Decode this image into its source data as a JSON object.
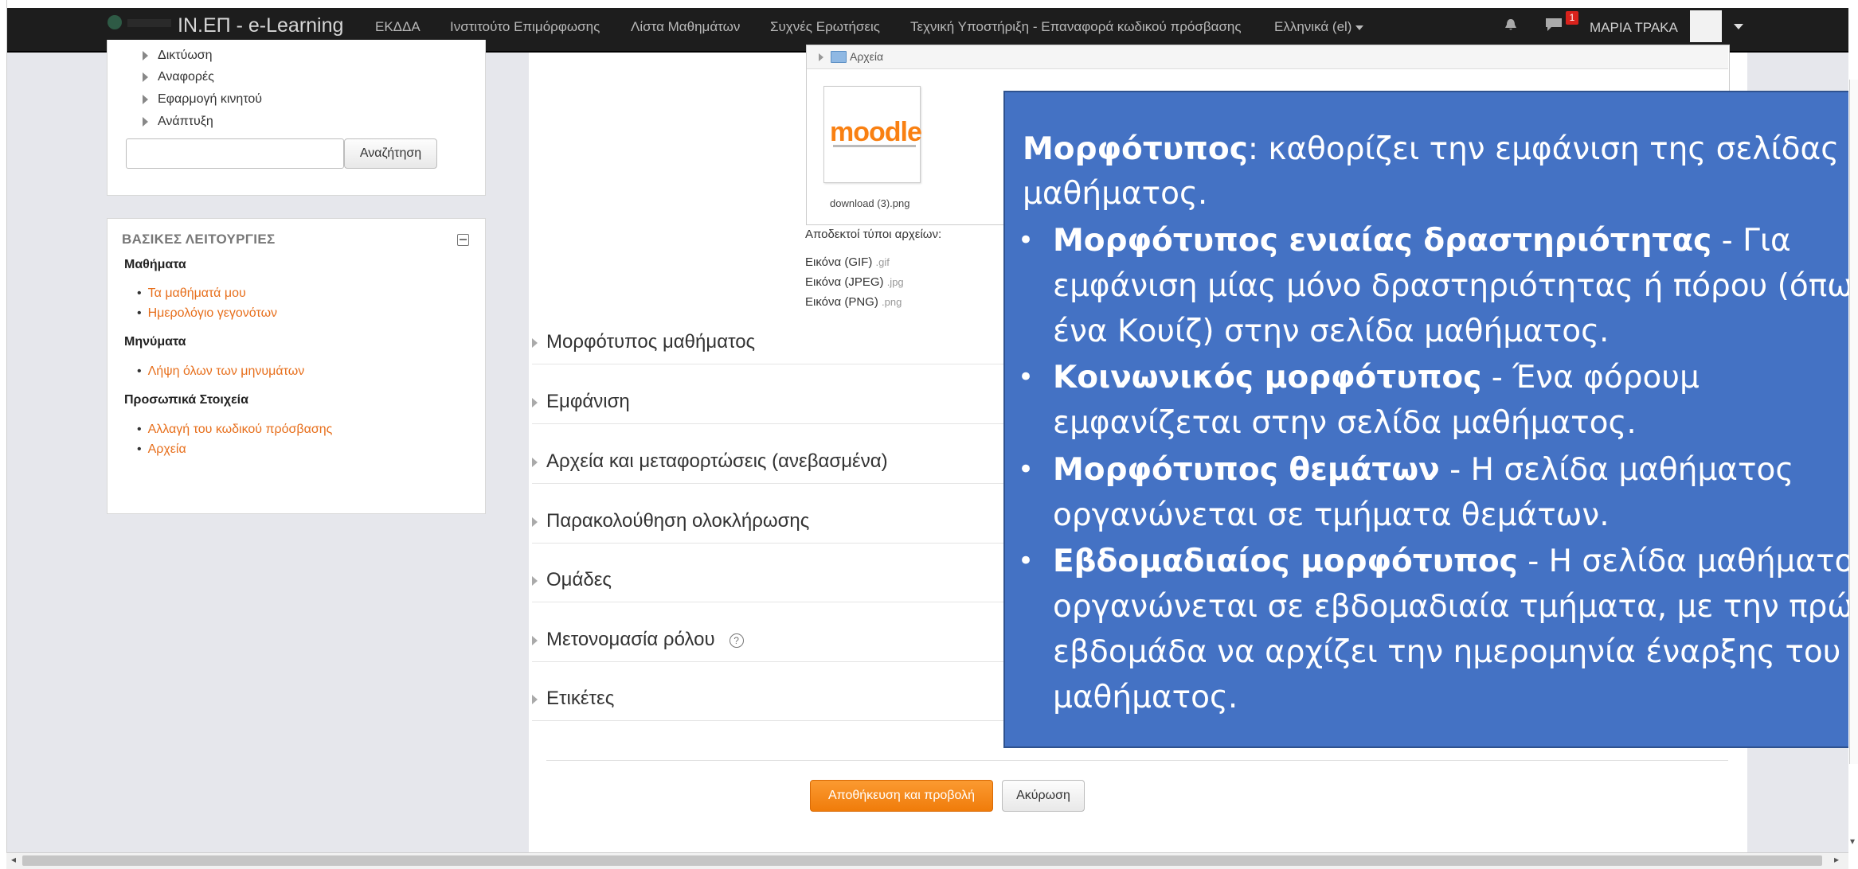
{
  "navbar": {
    "brand": "ΙΝ.ΕΠ - e-Learning",
    "links": [
      "ΕΚΔΔΑ",
      "Ινστιτούτο Επιμόρφωσης",
      "Λίστα Μαθημάτων",
      "Συχνές Ερωτήσεις",
      "Τεχνική Υποστήριξη - Επαναφορά κωδικού πρόσβασης"
    ],
    "language": "Ελληνικά (el)",
    "messages_badge": "1",
    "user_name": "ΜΑΡΙΑ ΤΡΑΚΑ"
  },
  "sidebar": {
    "tree_items": [
      "Δικτύωση",
      "Αναφορές",
      "Εφαρμογή κινητού",
      "Ανάπτυξη"
    ],
    "search_value": "",
    "search_button": "Αναζήτηση",
    "block_title": "ΒΑΣΙΚΕΣ ΛΕΙΤΟΥΡΓΙΕΣ",
    "sections": [
      {
        "title": "Μαθήματα",
        "links": [
          "Τα μαθήματά μου",
          "Ημερολόγιο γεγονότων"
        ]
      },
      {
        "title": "Μηνύματα",
        "links": [
          "Λήψη όλων των μηνυμάτων"
        ]
      },
      {
        "title": "Προσωπικά Στοιχεία",
        "links": [
          "Αλλαγή του κωδικού πρόσβασης",
          "Αρχεία"
        ]
      }
    ]
  },
  "files": {
    "folder": "Αρχεία",
    "file_name": "download (3).png",
    "thumb_logo": "moodle",
    "accepted_label": "Αποδεκτοί τύποι αρχείων:",
    "types": [
      {
        "name": "Εικόνα (GIF)",
        "ext": ".gif"
      },
      {
        "name": "Εικόνα (JPEG)",
        "ext": ".jpg"
      },
      {
        "name": "Εικόνα (PNG)",
        "ext": ".png"
      }
    ]
  },
  "sections": [
    "Μορφότυπος μαθήματος",
    "Εμφάνιση",
    "Αρχεία και μεταφορτώσεις (ανεβασμένα)",
    "Παρακολούθηση ολοκλήρωσης",
    "Ομάδες",
    "Μετονομασία ρόλου",
    "Ετικέτες"
  ],
  "help_icon": "?",
  "buttons": {
    "save": "Αποθήκευση και προβολή",
    "cancel": "Ακύρωση"
  },
  "overlay": {
    "intro_bold": "Μορφότυπος",
    "intro_rest": ": καθορίζει την εμφάνιση της σελίδας μαθήματος.",
    "items": [
      {
        "bold": "Μορφότυπος ενιαίας δραστηριότητας",
        "rest": " - Για εμφάνιση μίας μόνο δραστηριότητας ή πόρου (όπως ένα Κουίζ) στην σελίδα μαθήματος."
      },
      {
        "bold": "Κοινωνικός μορφότυπος",
        "rest": " - Ένα φόρουμ εμφανίζεται στην σελίδα μαθήματος."
      },
      {
        "bold": "Μορφότυπος θεμάτων",
        "rest": " - Η σελίδα μαθήματος οργανώνεται σε τμήματα θεμάτων."
      },
      {
        "bold": "Εβδομαδιαίος μορφότυπος",
        "rest": " - Η σελίδα μαθήματος οργανώνεται σε εβδομαδιαία τμήματα, με την πρώτη εβδομάδα να αρχίζει την ημερομηνία έναρξης του μαθήματος."
      }
    ]
  },
  "colors": {
    "accent": "#f98012",
    "link": "#e76f1c",
    "overlay": "#4472c4",
    "navbar": "#1d1d1d"
  }
}
